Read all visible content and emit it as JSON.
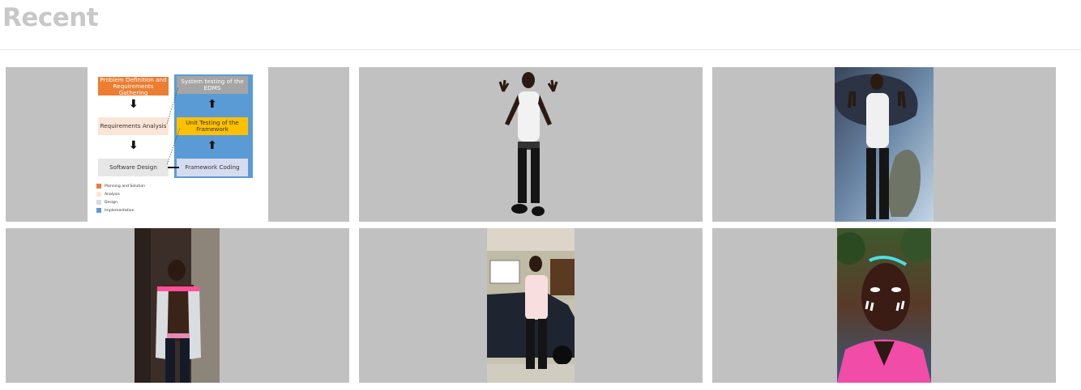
{
  "page": {
    "title": "Recent"
  },
  "diagram": {
    "boxes": {
      "problem_definition": "Problem Definition and Requirements Gathering",
      "requirements_analysis": "Requirements Analysis",
      "software_design": "Software Design",
      "system_testing": "System testing of the EDMS",
      "unit_testing": "Unit Testing of the Framework",
      "framework_coding": "Framework Coding"
    },
    "legend": [
      {
        "label": "Planning and Solution",
        "color": "#ed7d31"
      },
      {
        "label": "Analysis",
        "color": "#fbe5d6"
      },
      {
        "label": "Design",
        "color": "#d9d9d9"
      },
      {
        "label": "Implementation",
        "color": "#5b9bd5"
      }
    ]
  },
  "thumbnails": [
    {
      "kind": "diagram"
    },
    {
      "kind": "photo",
      "subject": "person standing, cut-out"
    },
    {
      "kind": "photo",
      "subject": "person with panther and peacock art"
    },
    {
      "kind": "photo",
      "subject": "person in open vest by doorway"
    },
    {
      "kind": "photo",
      "subject": "person by parked car"
    },
    {
      "kind": "photo",
      "subject": "selfie with pink shirt"
    }
  ]
}
